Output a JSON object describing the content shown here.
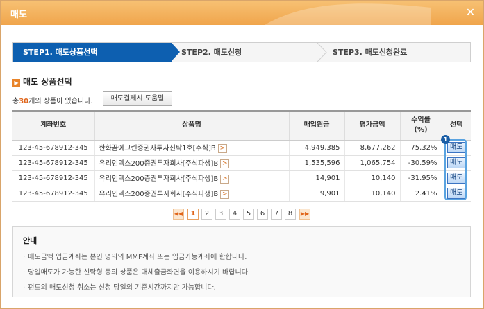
{
  "window": {
    "title": "매도"
  },
  "steps": [
    {
      "label": "STEP1. 매도상품선택",
      "active": true
    },
    {
      "label": "STEP2. 매도신청",
      "active": false
    },
    {
      "label": "STEP3. 매도신청완료",
      "active": false
    }
  ],
  "section": {
    "title": "매도 상품선택",
    "count_prefix": "총",
    "count": "30",
    "count_suffix": "개의 상품이 있습니다.",
    "help_button": "매도결제시 도움말"
  },
  "table": {
    "headers": [
      "계좌번호",
      "상품명",
      "매입원금",
      "평가금액",
      "수익률\n(%)",
      "선택"
    ],
    "rows": [
      {
        "account": "123-45-678912-345",
        "product": "한화꿈에그린증권자투자신탁1호[주식]B",
        "principal": "4,949,385",
        "value": "8,677,262",
        "return": "75.32%",
        "action": "매도"
      },
      {
        "account": "123-45-678912-345",
        "product": "유리인덱스200증권투자회사[주식파생]B",
        "principal": "1,535,596",
        "value": "1,065,754",
        "return": "-30.59%",
        "action": "매도"
      },
      {
        "account": "123-45-678912-345",
        "product": "유리인덱스200증권투자회사[주식파생]B",
        "principal": "14,901",
        "value": "10,140",
        "return": "-31.95%",
        "action": "매도"
      },
      {
        "account": "123-45-678912-345",
        "product": "유리인덱스200증권투자회사[주식파생]B",
        "principal": "9,901",
        "value": "10,140",
        "return": "2.41%",
        "action": "매도"
      }
    ],
    "badge": "1"
  },
  "pager": {
    "first": "◀◀",
    "last": "▶▶",
    "pages": [
      "1",
      "2",
      "3",
      "4",
      "5",
      "6",
      "7",
      "8"
    ],
    "current": "1"
  },
  "notice": {
    "title": "안내",
    "items": [
      "매도금액 입금계좌는 본인 명의의 MMF계좌 또는 입금가능계좌에 한합니다.",
      "당일매도가 가능한 신탁형 등의 상품은 대체출금화면을 이용하시기 바랍니다.",
      "펀드의 매도신청 취소는 신청 당일의 기준시간까지만 가능합니다."
    ]
  },
  "icons": {
    "close": "close-icon",
    "section": "section-bullet-icon",
    "more": "chevron-right-icon"
  },
  "colors": {
    "titlebar": "#f0a54c",
    "active_step": "#0d5fb0",
    "accent": "#e0651a",
    "sell_border": "#3b74c3"
  }
}
